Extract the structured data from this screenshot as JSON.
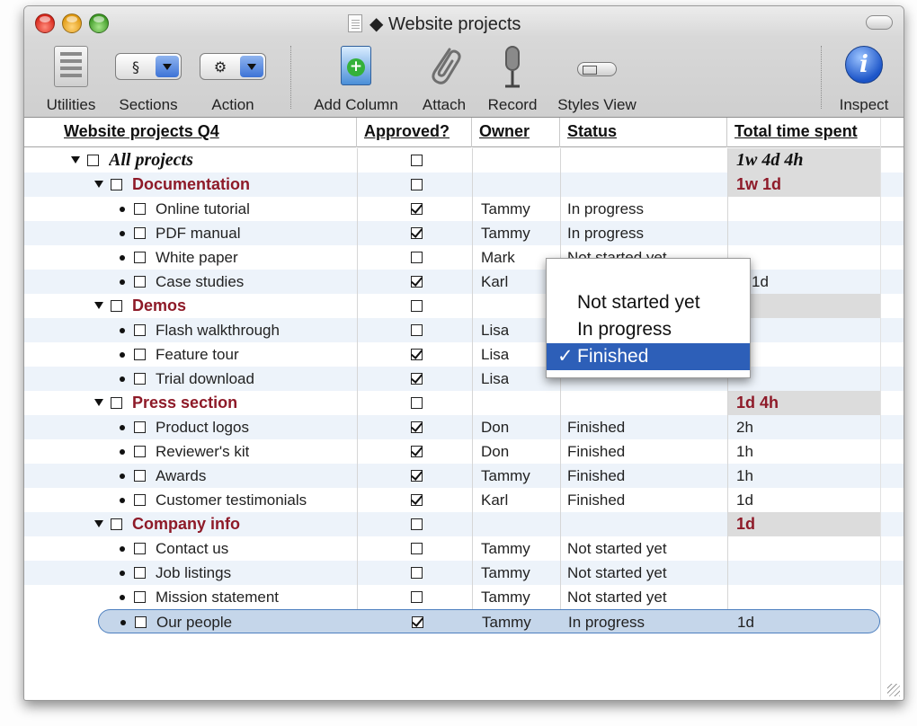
{
  "window": {
    "title": "Website projects"
  },
  "toolbar": {
    "utilities": "Utilities",
    "sections": "Sections",
    "sections_glyph": "§",
    "action": "Action",
    "action_glyph": "⚙",
    "add_column": "Add Column",
    "attach": "Attach",
    "record": "Record",
    "styles_view": "Styles View",
    "inspect": "Inspect"
  },
  "columns": [
    "Website projects Q4",
    "Approved?",
    "Owner",
    "Status",
    "Total time spent"
  ],
  "rows": [
    {
      "level": 0,
      "kind": "root",
      "topic": "All projects",
      "approved": false,
      "owner": "",
      "status": "",
      "total": "1w 4d 4h"
    },
    {
      "level": 1,
      "kind": "section",
      "topic": "Documentation",
      "approved": false,
      "owner": "",
      "status": "",
      "total": "1w 1d"
    },
    {
      "level": 2,
      "kind": "item",
      "topic": "Online tutorial",
      "approved": true,
      "owner": "Tammy",
      "status": "In progress",
      "total": ""
    },
    {
      "level": 2,
      "kind": "item",
      "topic": "PDF manual",
      "approved": true,
      "owner": "Tammy",
      "status": "In progress",
      "total": ""
    },
    {
      "level": 2,
      "kind": "item",
      "topic": "White paper",
      "approved": false,
      "owner": "Mark",
      "status": "Not started yet",
      "total": ""
    },
    {
      "level": 2,
      "kind": "item",
      "topic": "Case studies",
      "approved": true,
      "owner": "Karl",
      "status": "",
      "total": "w 1d"
    },
    {
      "level": 1,
      "kind": "section",
      "topic": "Demos",
      "approved": false,
      "owner": "",
      "status": "",
      "total": "d"
    },
    {
      "level": 2,
      "kind": "item",
      "topic": "Flash walkthrough",
      "approved": false,
      "owner": "Lisa",
      "status": "",
      "total": ""
    },
    {
      "level": 2,
      "kind": "item",
      "topic": "Feature tour",
      "approved": true,
      "owner": "Lisa",
      "status": "",
      "total": ""
    },
    {
      "level": 2,
      "kind": "item",
      "topic": "Trial download",
      "approved": true,
      "owner": "Lisa",
      "status": "",
      "total": ""
    },
    {
      "level": 1,
      "kind": "section",
      "topic": "Press section",
      "approved": false,
      "owner": "",
      "status": "",
      "total": "1d 4h"
    },
    {
      "level": 2,
      "kind": "item",
      "topic": "Product logos",
      "approved": true,
      "owner": "Don",
      "status": "Finished",
      "total": "2h"
    },
    {
      "level": 2,
      "kind": "item",
      "topic": "Reviewer's kit",
      "approved": true,
      "owner": "Don",
      "status": "Finished",
      "total": "1h"
    },
    {
      "level": 2,
      "kind": "item",
      "topic": "Awards",
      "approved": true,
      "owner": "Tammy",
      "status": "Finished",
      "total": "1h"
    },
    {
      "level": 2,
      "kind": "item",
      "topic": "Customer testimonials",
      "approved": true,
      "owner": "Karl",
      "status": "Finished",
      "total": "1d"
    },
    {
      "level": 1,
      "kind": "section",
      "topic": "Company info",
      "approved": false,
      "owner": "",
      "status": "",
      "total": "1d"
    },
    {
      "level": 2,
      "kind": "item",
      "topic": "Contact us",
      "approved": false,
      "owner": "Tammy",
      "status": "Not started yet",
      "total": ""
    },
    {
      "level": 2,
      "kind": "item",
      "topic": "Job listings",
      "approved": false,
      "owner": "Tammy",
      "status": "Not started yet",
      "total": ""
    },
    {
      "level": 2,
      "kind": "item",
      "topic": "Mission statement",
      "approved": false,
      "owner": "Tammy",
      "status": "Not started yet",
      "total": ""
    },
    {
      "level": 2,
      "kind": "item",
      "topic": "Our people",
      "approved": true,
      "owner": "Tammy",
      "status": "In progress",
      "total": "1d",
      "selected": true
    }
  ],
  "status_menu": {
    "options": [
      "Not started yet",
      "In progress",
      "Finished"
    ],
    "selected": "Finished"
  },
  "colors": {
    "section_text": "#8e1a28",
    "row_alt": "#edf3fa",
    "menu_selected": "#2d5fb8"
  }
}
